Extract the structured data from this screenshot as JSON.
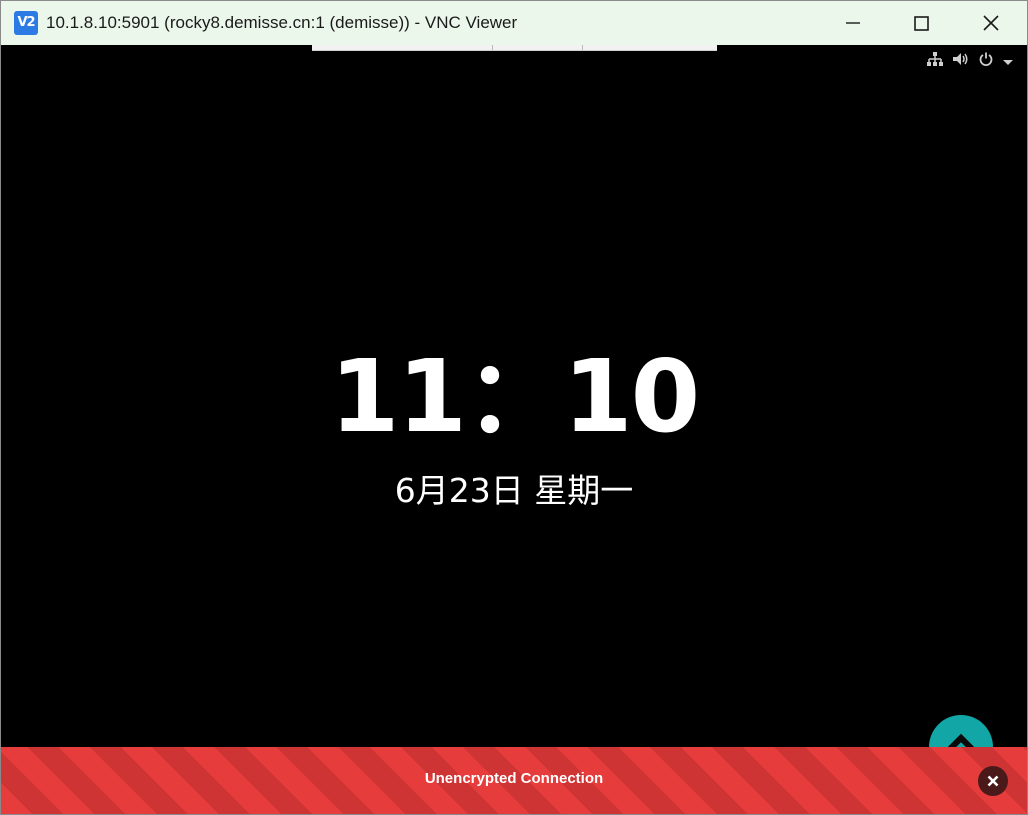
{
  "window": {
    "title": "10.1.8.10:5901 (rocky8.demisse.cn:1 (demisse)) - VNC Viewer",
    "app_icon_text": "V2",
    "controls": [
      "minimize-icon",
      "maximize-icon",
      "close-icon"
    ]
  },
  "remote_screen": {
    "status_icons": [
      "network-icon",
      "volume-icon",
      "power-icon",
      "chevron-down-icon"
    ],
    "clock": "11：10",
    "date": "6月23日 星期一"
  },
  "banner": {
    "text": "Unencrypted Connection",
    "bg_color": "#e63c3c"
  },
  "colors": {
    "titlebar": "#ecf7ec",
    "fab": "#12a6a6",
    "app_icon": "#2c7be5"
  }
}
